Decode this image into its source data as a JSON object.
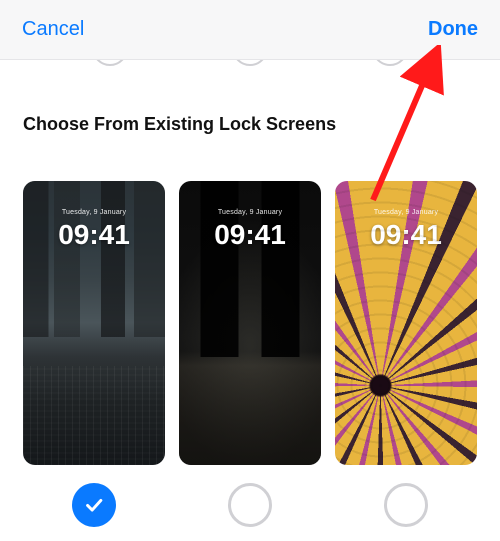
{
  "nav": {
    "cancel": "Cancel",
    "done": "Done"
  },
  "section_title": "Choose From Existing Lock Screens",
  "lock_screens": [
    {
      "date": "Tuesday, 9 January",
      "time": "09:41",
      "style": "city-grey",
      "selected": true
    },
    {
      "date": "Tuesday, 9 January",
      "time": "09:41",
      "style": "night-dark",
      "selected": false
    },
    {
      "date": "Tuesday, 9 January",
      "time": "09:41",
      "style": "emoji-spiral",
      "selected": false
    }
  ],
  "colors": {
    "accent": "#0a7aff"
  },
  "annotation": {
    "arrow_target": "done-button",
    "color": "#ff1a1a"
  }
}
